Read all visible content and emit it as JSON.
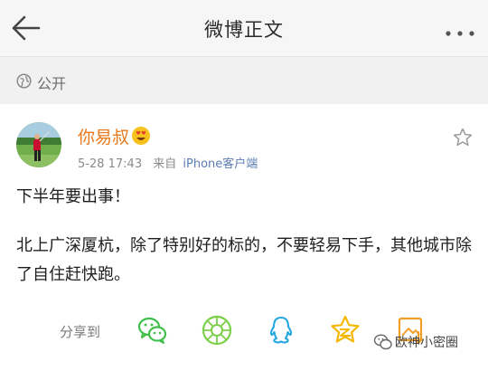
{
  "header": {
    "title": "微博正文",
    "back_icon": "arrow-left-icon",
    "more_icon": "more-dots-icon"
  },
  "privacy": {
    "icon": "globe-icon",
    "label": "公开"
  },
  "post": {
    "author": {
      "name": "你易叔",
      "badge_icon": "emoji-badge-icon"
    },
    "time": "5-28 17:43",
    "via_label": "来自",
    "client": "iPhone客户端",
    "favorite_icon": "star-outline-icon",
    "text": {
      "line1": "下半年要出事！",
      "paragraph2": "北上广深厦杭，除了特别好的标的，不要轻易下手，其他城市除了自住赶快跑。"
    }
  },
  "share": {
    "label": "分享到",
    "targets": [
      {
        "icon": "wechat-icon",
        "color": "#40c04a"
      },
      {
        "icon": "moments-icon",
        "color": "#7ccf48"
      },
      {
        "icon": "qq-icon",
        "color": "#25a8e0"
      },
      {
        "icon": "qzone-icon",
        "color": "#f5b700"
      },
      {
        "icon": "album-icon",
        "color": "#f0a02a"
      }
    ]
  },
  "watermark": {
    "text": "欧神小密圈"
  },
  "colors": {
    "accent_username": "#e8781b",
    "link": "#5b7cb1",
    "header_bg": "#f6f6f6"
  }
}
